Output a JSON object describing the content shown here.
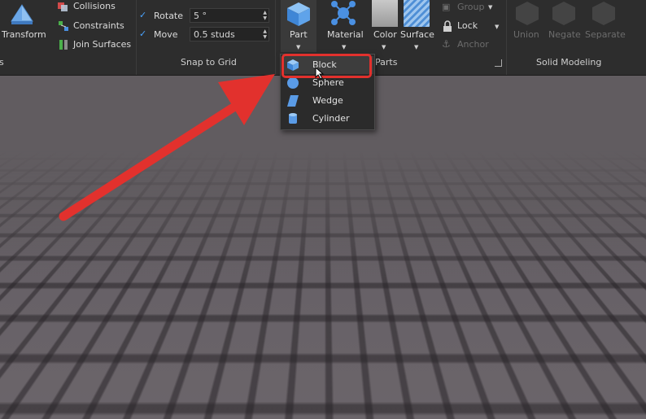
{
  "ribbon": {
    "transform": {
      "label": "Transform"
    },
    "constraints_group": {
      "collisions": "Collisions",
      "constraints": "Constraints",
      "join_surfaces": "Join Surfaces",
      "partial_title": "ls"
    },
    "snap_to_grid": {
      "title": "Snap to Grid",
      "rotate": {
        "label": "Rotate",
        "value": "5 °",
        "checked": true
      },
      "move": {
        "label": "Move",
        "value": "0.5 studs",
        "checked": true
      }
    },
    "parts": {
      "title": "Parts",
      "part": "Part",
      "material": "Material",
      "color": "Color",
      "surface": "Surface",
      "group": "Group",
      "lock": "Lock",
      "anchor": "Anchor"
    },
    "solid_modeling": {
      "title": "Solid Modeling",
      "union": "Union",
      "negate": "Negate",
      "separate": "Separate"
    }
  },
  "part_menu": {
    "items": [
      {
        "label": "Block",
        "icon": "block-icon",
        "selected": true
      },
      {
        "label": "Sphere",
        "icon": "sphere-icon"
      },
      {
        "label": "Wedge",
        "icon": "wedge-icon"
      },
      {
        "label": "Cylinder",
        "icon": "cylinder-icon"
      }
    ]
  },
  "colors": {
    "accent_blue": "#4a90e2",
    "highlight_red": "#e2312d",
    "ribbon_bg": "#2d2d2d"
  }
}
